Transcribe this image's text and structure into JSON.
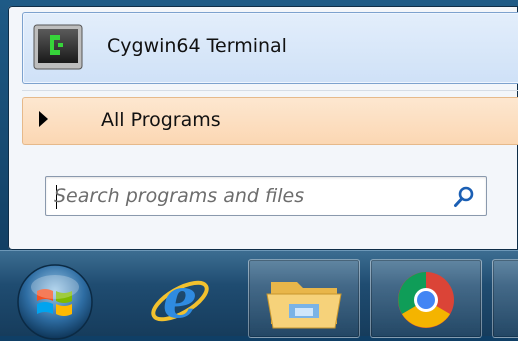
{
  "start_menu": {
    "pinned_program": {
      "label": "Cygwin64 Terminal",
      "icon": "cygwin-terminal-icon"
    },
    "all_programs": {
      "label": "All Programs",
      "icon": "triangle-right-icon"
    },
    "search": {
      "placeholder": "Search programs and files",
      "value": "",
      "icon": "search-icon"
    }
  },
  "taskbar": {
    "items": [
      {
        "name": "start-orb",
        "icon": "windows-logo-icon"
      },
      {
        "name": "internet-explorer",
        "icon": "internet-explorer-icon"
      },
      {
        "name": "windows-explorer",
        "icon": "folder-icon"
      },
      {
        "name": "google-chrome",
        "icon": "chrome-icon"
      }
    ]
  },
  "colors": {
    "highlight_blue": "#cfe1f7",
    "highlight_orange": "#fbd7b3",
    "taskbar": "#1f4c71"
  }
}
